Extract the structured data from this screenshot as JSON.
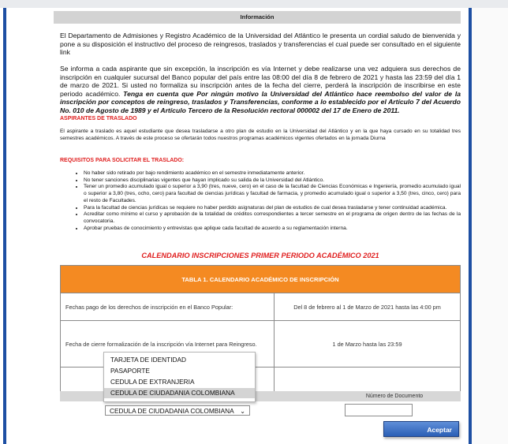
{
  "header": {
    "title": "Información"
  },
  "intro": "El Departamento de Admisiones y Registro Académico de la Universidad del Atlántico le presenta un cordial saludo de bienvenida y pone a su disposición el instructivo del proceso de reingresos, traslados y transferencias el cual puede ser consultado en el siguiente link",
  "notice": {
    "plain": "Se informa a cada aspirante que sin excepción, la inscripción es vía Internet y debe realizarse una vez adquiera sus derechos de inscripción en cualquier sucursal del Banco popular del país entre las 08:00 del día 8 de febrero de 2021 y hasta las 23:59 del día 1 de marzo de 2021. Si usted no formaliza su inscripción antes de la fecha del cierre, perderá la inscripción de inscribirse en este periodo académico.",
    "bold": "Tenga en cuenta que Por ningún motivo la Universidad del Atlántico hace reembolso del valor de la inscripción por conceptos de reingreso, traslados y Transferencias, conforme a lo establecido por el Artículo 7 del Acuerdo No. 010 de Agosto de 1989 y el Artículo Tercero de la Resolución rectoral 000002 del 17 de Enero de 2011."
  },
  "aspirantes": {
    "heading": "ASPIRANTES DE TRASLADO",
    "text": "El aspirante a traslado es aquel estudiante que desea trasladarse a otro plan de estudio en la Universidad del Atlántico y en la que haya cursado en su totalidad tres semestres académicos. A través de este proceso se ofertarán todos nuestros programas académicos vigentes ofertados en la jornada Diurna"
  },
  "requisitos": {
    "heading": "REQUISITOS PARA SOLICITAR EL TRASLADO:",
    "items": [
      "No haber sido retirado por bajo rendimiento académico en el semestre inmediatamente anterior.",
      "No tener sanciones disciplinarias vigentes que hayan implicado su salida de la Universidad del Atlántico.",
      "Tener un promedio acumulado igual o superior a 3,90 (tres, nueve, cero) en el caso de la facultad de Ciencias Económicas e Ingeniería, promedio acumulado igual o superior a 3,80 (tres, ocho, cero) para facultad de ciencias jurídicas y facultad de farmacia, y promedio acumulado igual o superior a 3,50 (tres, cinco, cero) para el resto de Facultades.",
      "Para la facultad de ciencias jurídicas se requiere no haber perdido asignaturas del plan de estudios de cual desea trasladarse y tener continuidad académica.",
      "Acreditar como mínimo el curso y aprobación de la totalidad de créditos correspondientes a tercer semestre en el programa de origen dentro de las fechas de la convocatoria.",
      "Aprobar pruebas de conocimiento y entrevistas que aplique cada facultad de acuerdo a su reglamentación interna."
    ]
  },
  "calendar": {
    "title": "CALENDARIO INSCRIPCIONES PRIMER PERIODO ACADÉMICO 2021",
    "table_title": "TABLA 1. CALENDARIO ACADÉMICO DE INSCRIPCIÓN",
    "rows": [
      {
        "label": "Fechas pago de los derechos de inscripción en el Banco Popular:",
        "value": "Del 8 de febrero al 1 de Marzo de 2021 hasta las 4:00 pm"
      },
      {
        "label": "Fecha de cierre formalización de la inscripción vía Internet para Reingreso.",
        "value": "1 de Marzo hasta las 23:59"
      }
    ]
  },
  "document": {
    "number_label": "Número de Documento",
    "number_value": "",
    "options": [
      "TARJETA DE IDENTIDAD",
      "PASAPORTE",
      "CEDULA DE EXTRANJERIA",
      "CEDULA DE CIUDADANIA COLOMBIANA"
    ],
    "selected": "CEDULA DE CIUDADANIA COLOMBIANA"
  },
  "accept_label": "Aceptar",
  "colors": {
    "accent": "#1d4fa3",
    "table_header": "#f48a22",
    "highlight": "#e02020"
  }
}
